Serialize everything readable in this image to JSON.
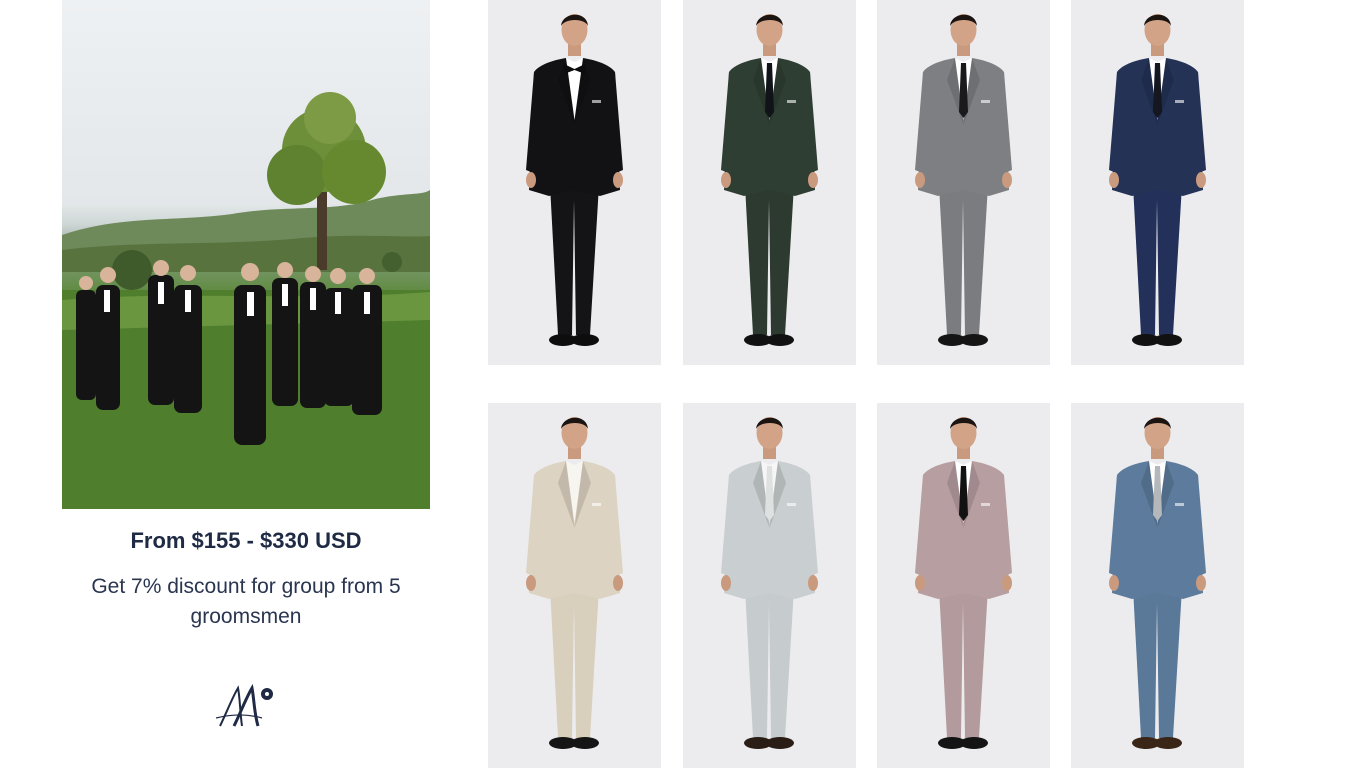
{
  "hero": {
    "image": "groomsmen-group-photo"
  },
  "offer": {
    "price_text": "From $155 - $330 USD",
    "discount_text": "Get 7% discount for group from 5 groomsmen"
  },
  "logo": {
    "icon": "brand-monogram-logo"
  },
  "suits": [
    {
      "name": "black-tuxedo",
      "jacket": "#121214",
      "pants": "#141416",
      "shirt": "#ffffff",
      "tie": "#0c0c0e",
      "tie_style": "bow",
      "shoes": "#0d0d0d",
      "bg": "#ececef"
    },
    {
      "name": "dark-green-suit",
      "jacket": "#2f3e33",
      "pants": "#2c3a30",
      "shirt": "#ffffff",
      "tie": "#101418",
      "tie_style": "long",
      "shoes": "#111111",
      "bg": "#ececef"
    },
    {
      "name": "grey-suit",
      "jacket": "#7d7f82",
      "pants": "#7a7c7f",
      "shirt": "#ffffff",
      "tie": "#1a1a1c",
      "tie_style": "long",
      "shoes": "#151515",
      "bg": "#ececef"
    },
    {
      "name": "navy-blue-suit",
      "jacket": "#243256",
      "pants": "#22305a",
      "shirt": "#ffffff",
      "tie": "#141620",
      "tie_style": "long",
      "shoes": "#111111",
      "bg": "#ececef"
    },
    {
      "name": "beige-linen-suit",
      "jacket": "#ddd3c2",
      "pants": "#d9cfbd",
      "shirt": "#f7f5f0",
      "tie": "none",
      "tie_style": "none",
      "shoes": "#151515",
      "bg": "#ececef"
    },
    {
      "name": "light-grey-suit",
      "jacket": "#c9ced0",
      "pants": "#c6cbcd",
      "shirt": "#f6f6f6",
      "tie": "#dfe1e1",
      "tie_style": "long",
      "shoes": "#2a1d16",
      "bg": "#ececef"
    },
    {
      "name": "dusty-pink-suit",
      "jacket": "#b79ea1",
      "pants": "#b39a9d",
      "shirt": "#ffffff",
      "tie": "#121212",
      "tie_style": "long",
      "shoes": "#141414",
      "bg": "#ececef"
    },
    {
      "name": "blue-three-piece",
      "jacket": "#5d7b9c",
      "pants": "#5a7898",
      "shirt": "#ffffff",
      "tie": "#b5b8bb",
      "tie_style": "long",
      "shoes": "#3a2617",
      "bg": "#ececef"
    }
  ]
}
